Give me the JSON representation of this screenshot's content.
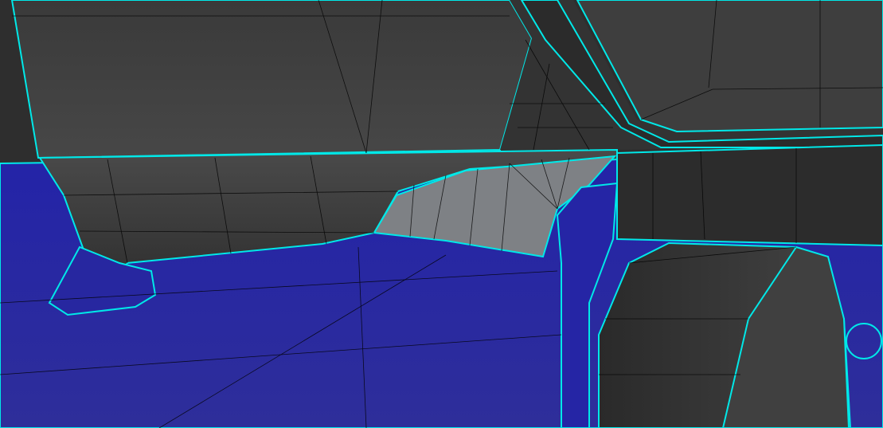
{
  "viewport": {
    "colors": {
      "background": "#2e2e2e",
      "body_blue": "#2b2ba0",
      "dark_panel": "#404040",
      "darker_panel": "#2c2c2c",
      "light_wing": "#7e8185",
      "edge_highlight": "#00e8e8",
      "wire": "#000000"
    }
  }
}
